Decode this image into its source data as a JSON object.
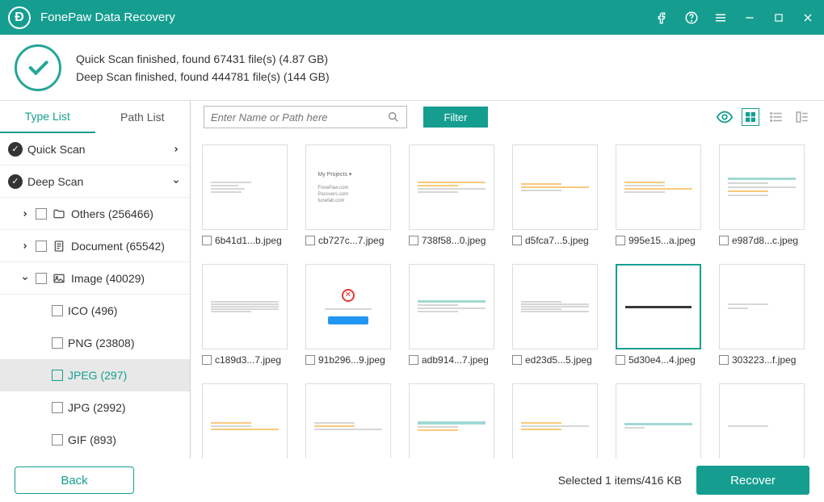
{
  "app_title": "FonePaw Data Recovery",
  "status": {
    "quick": "Quick Scan finished, found 67431 file(s) (4.87 GB)",
    "deep": "Deep Scan finished, found 444781 file(s) (144 GB)"
  },
  "tabs": {
    "type": "Type List",
    "path": "Path List"
  },
  "search_placeholder": "Enter Name or Path here",
  "filter_label": "Filter",
  "tree": {
    "quick_scan": "Quick Scan",
    "deep_scan": "Deep Scan",
    "others": "Others (256466)",
    "document": "Document (65542)",
    "image": "Image (40029)",
    "ico": "ICO (496)",
    "png": "PNG (23808)",
    "jpeg": "JPEG (297)",
    "jpg": "JPG (2992)",
    "gif": "GIF (893)"
  },
  "files": [
    "6b41d1...b.jpeg",
    "cb727c...7.jpeg",
    "738f58...0.jpeg",
    "d5fca7...5.jpeg",
    "995e15...a.jpeg",
    "e987d8...c.jpeg",
    "c189d3...7.jpeg",
    "91b296...9.jpeg",
    "adb914...7.jpeg",
    "ed23d5...5.jpeg",
    "5d30e4...4.jpeg",
    "303223...f.jpeg"
  ],
  "footer": {
    "back": "Back",
    "selected": "Selected 1 items/416 KB",
    "recover": "Recover"
  }
}
